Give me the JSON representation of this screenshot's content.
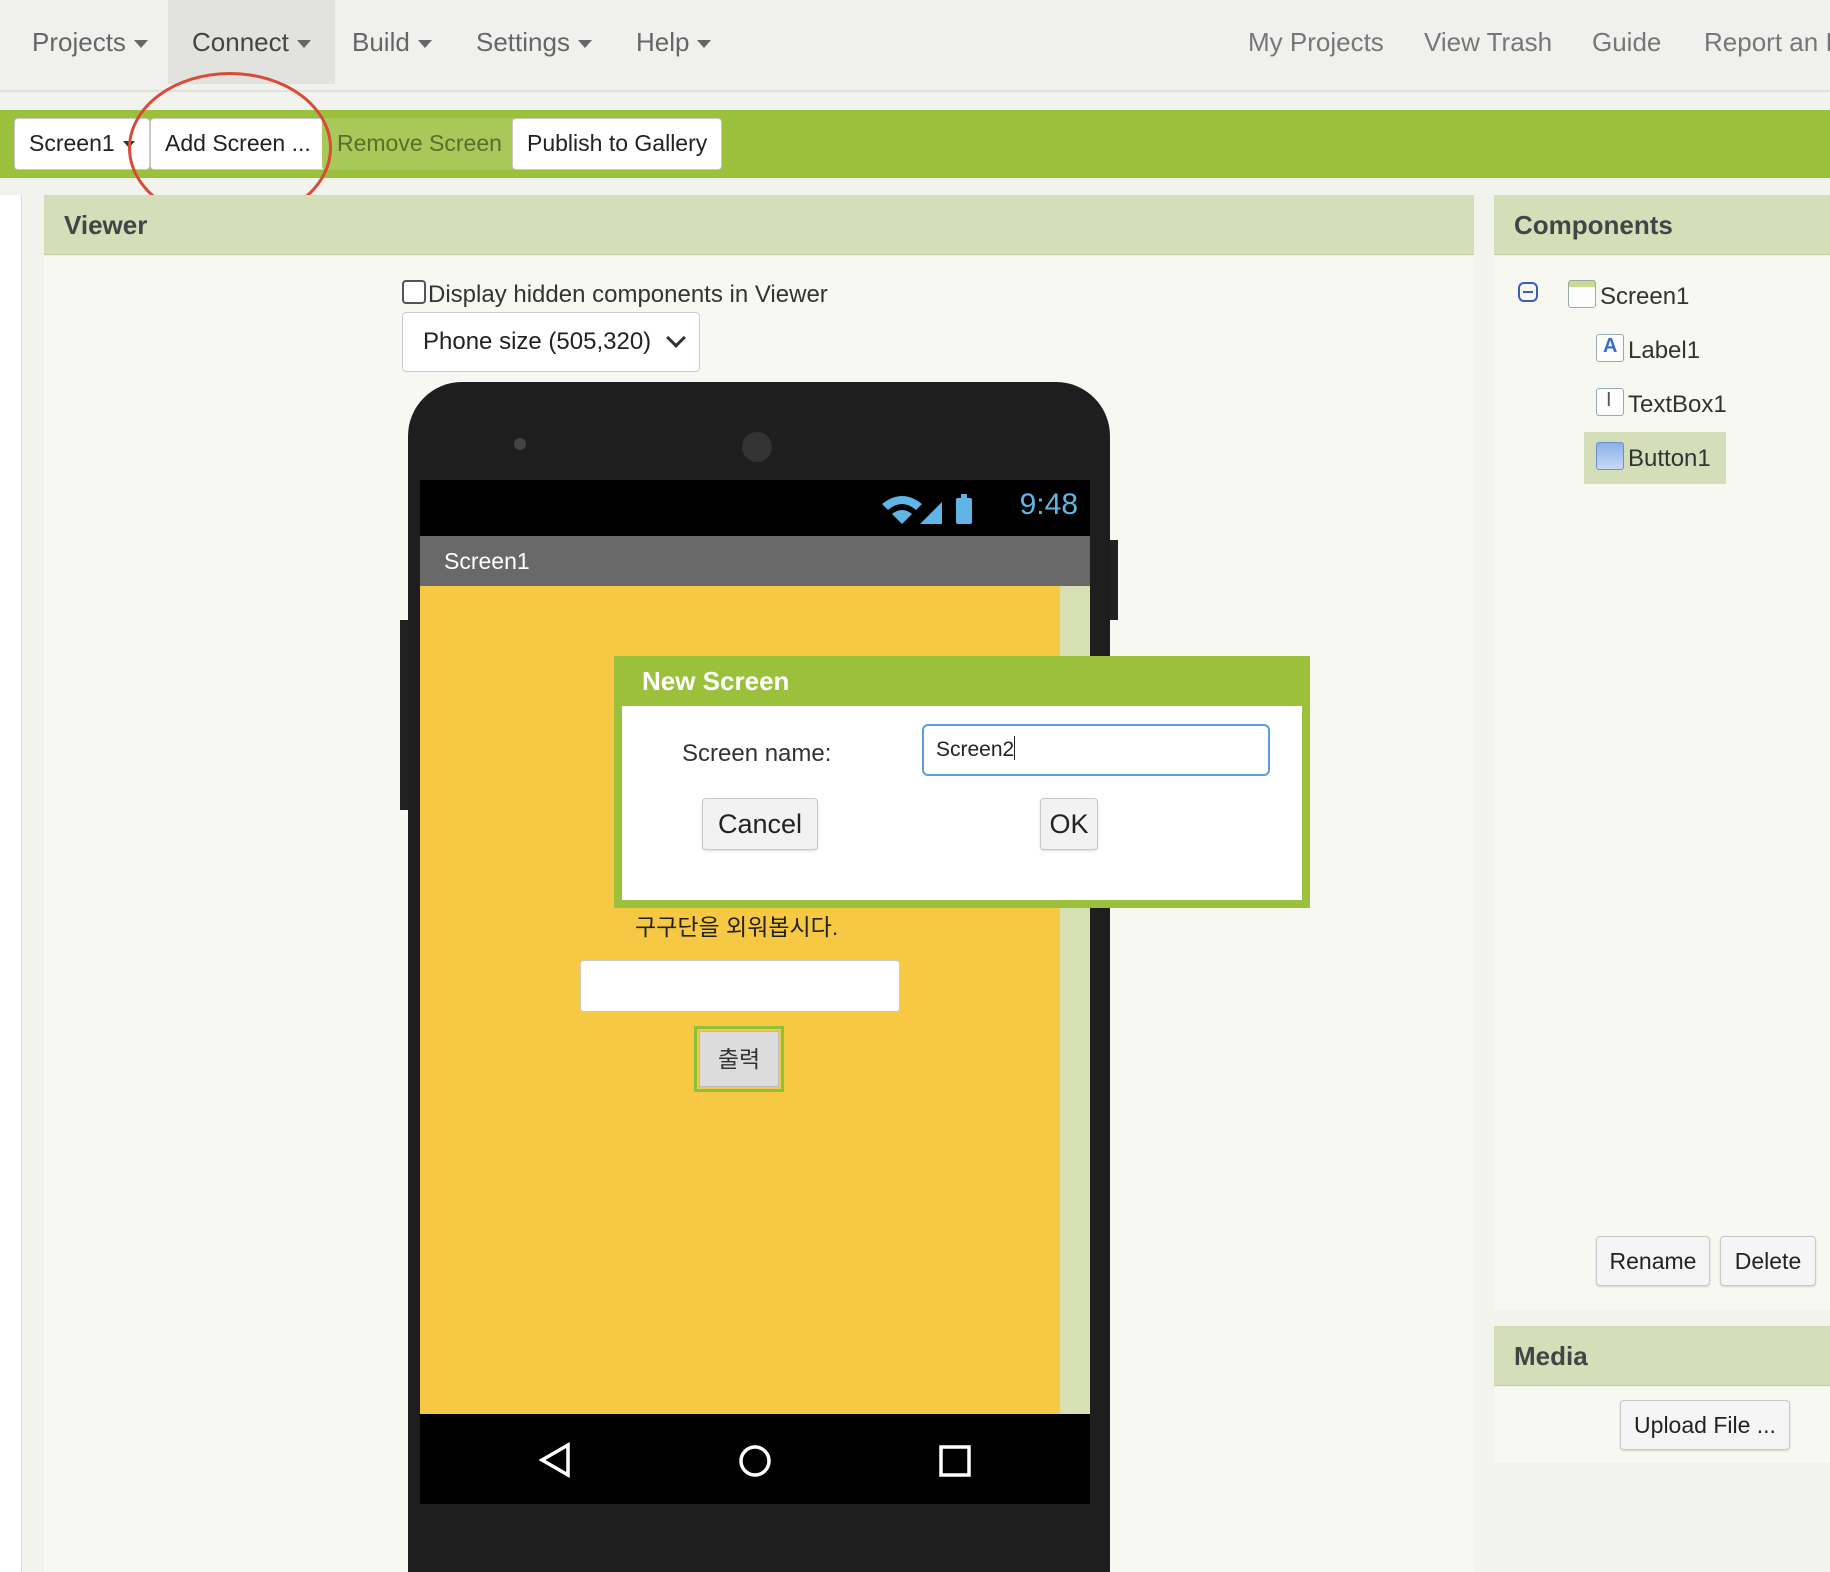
{
  "topnav": {
    "menus": [
      {
        "label": "Projects"
      },
      {
        "label": "Connect"
      },
      {
        "label": "Build"
      },
      {
        "label": "Settings"
      },
      {
        "label": "Help"
      }
    ],
    "links": [
      "My Projects",
      "View Trash",
      "Guide",
      "Report an Is"
    ]
  },
  "toolbar": {
    "screen_select": "Screen1",
    "add_screen": "Add Screen ...",
    "remove_screen": "Remove Screen",
    "publish": "Publish to Gallery"
  },
  "viewer": {
    "title": "Viewer",
    "hidden_checkbox_label": "Display hidden components in Viewer",
    "hidden_checked": false,
    "phone_size": "Phone size (505,320)"
  },
  "phone": {
    "time": "9:48",
    "screen_title": "Screen1",
    "label_text": "구구단을 외워봅시다.",
    "button_text": "출력",
    "background_color": "#f7c843"
  },
  "dialog": {
    "title": "New Screen",
    "name_label": "Screen name:",
    "name_value": "Screen2",
    "cancel": "Cancel",
    "ok": "OK"
  },
  "components": {
    "title": "Components",
    "tree": {
      "root": "Screen1",
      "children": [
        "Label1",
        "TextBox1",
        "Button1"
      ],
      "selected": "Button1"
    },
    "rename": "Rename",
    "delete": "Delete"
  },
  "media": {
    "title": "Media",
    "upload": "Upload File ..."
  },
  "colors": {
    "accent_green": "#9bc03c",
    "panel_header": "#d4dfba",
    "annotation_red": "#d94a38"
  }
}
